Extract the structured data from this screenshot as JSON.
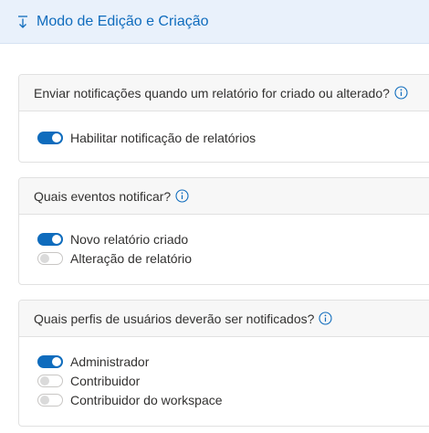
{
  "header": {
    "title": "Modo de Edição e Criação",
    "icon": "arrow-down-to-line-icon"
  },
  "accent_color": "#0f6cbd",
  "sections": [
    {
      "question": "Enviar notificações quando um relatório for criado ou alterado?",
      "options": [
        {
          "label": "Habilitar notificação de relatórios",
          "enabled": true
        }
      ]
    },
    {
      "question": "Quais eventos notificar?",
      "options": [
        {
          "label": "Novo relatório criado",
          "enabled": true
        },
        {
          "label": "Alteração de relatório",
          "enabled": false
        }
      ]
    },
    {
      "question": "Quais perfis de usuários deverão ser notificados?",
      "options": [
        {
          "label": "Administrador",
          "enabled": true
        },
        {
          "label": "Contribuidor",
          "enabled": false
        },
        {
          "label": "Contribuidor do workspace",
          "enabled": false
        }
      ]
    }
  ]
}
